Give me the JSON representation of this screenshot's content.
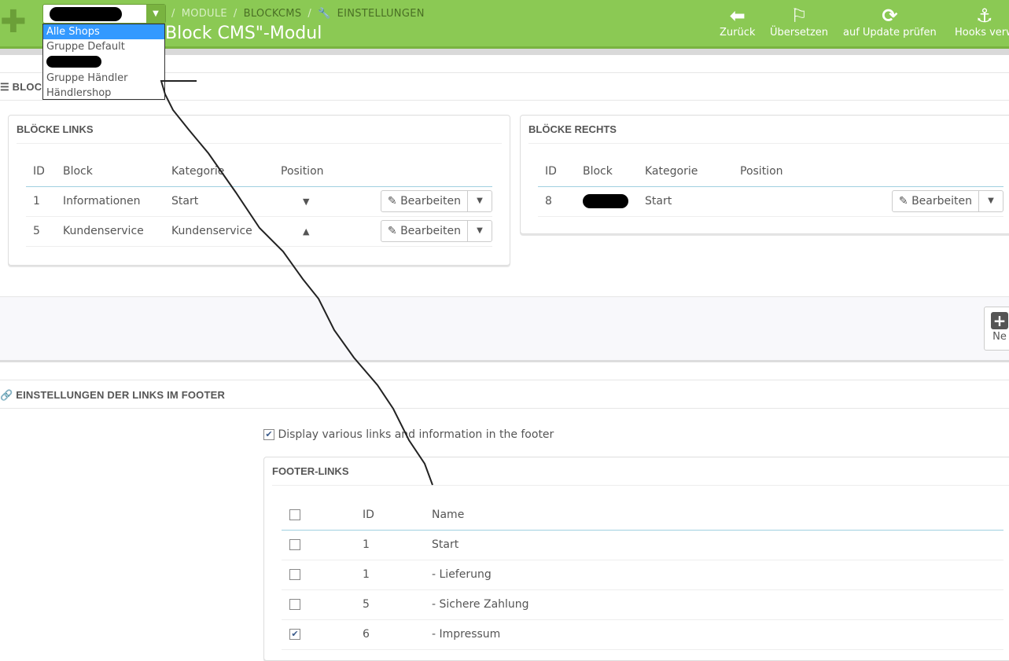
{
  "header": {
    "breadcrumb": [
      "MODULE",
      "BLOCKCMS",
      "EINSTELLUNGEN"
    ],
    "title": "Block CMS\"-Modul",
    "shop_dropdown": {
      "options": [
        "Alle Shops",
        "Gruppe Default",
        "",
        "Gruppe Händler",
        "Händlershop"
      ],
      "selected": "Alle Shops"
    },
    "toolbar": [
      {
        "label": "Zurück",
        "icon": "arrow-circle-left-icon"
      },
      {
        "label": "Übersetzen",
        "icon": "flag-icon"
      },
      {
        "label": "auf Update prüfen",
        "icon": "refresh-icon"
      },
      {
        "label": "Hooks verw",
        "icon": "anchor-icon"
      }
    ],
    "accent": "#8bc954"
  },
  "blocks_section": {
    "title": "BLOCK"
  },
  "left_panel": {
    "title": "BLÖCKE LINKS",
    "columns": [
      "ID",
      "Block",
      "Kategorie",
      "Position"
    ],
    "rows": [
      {
        "id": "1",
        "block": "Informationen",
        "category": "Start",
        "position": "▼",
        "action": "Bearbeiten"
      },
      {
        "id": "5",
        "block": "Kundenservice",
        "category": "Kundenservice",
        "position": "▲",
        "action": "Bearbeiten"
      }
    ]
  },
  "right_panel": {
    "title": "BLÖCKE RECHTS",
    "columns": [
      "ID",
      "Block",
      "Kategorie",
      "Position"
    ],
    "rows": [
      {
        "id": "8",
        "block": "",
        "category": "Start",
        "action": "Bearbeiten"
      }
    ]
  },
  "new_button": {
    "label": "Ne"
  },
  "footer_section": {
    "title": "EINSTELLUNGEN DER LINKS IM FOOTER",
    "checkbox_label": "Display various links and information in the footer",
    "checkbox_checked": true,
    "panel_title": "FOOTER-LINKS",
    "columns": [
      "ID",
      "Name"
    ],
    "rows": [
      {
        "id": "1",
        "name": "Start",
        "checked": false
      },
      {
        "id": "1",
        "name": "- Lieferung",
        "checked": false
      },
      {
        "id": "5",
        "name": "- Sichere Zahlung",
        "checked": false
      },
      {
        "id": "6",
        "name": "- Impressum",
        "checked": true
      }
    ]
  }
}
